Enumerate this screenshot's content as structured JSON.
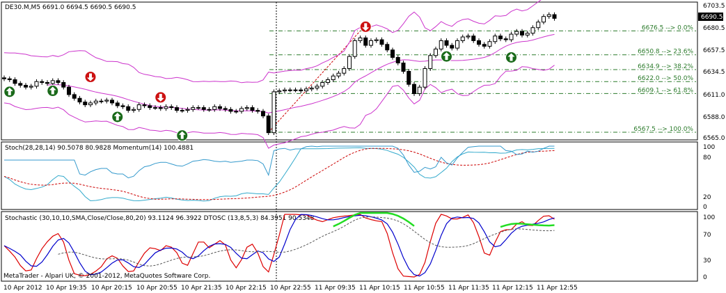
{
  "main": {
    "header": "DE30.M,M5  6691.0 6694.5 6690.5 6690.5",
    "price_badge": "6690.5",
    "price_ticks": [
      "6703.5",
      "6680.5",
      "6657.5",
      "6634.5",
      "6611.0",
      "6588.0",
      "6565.0"
    ],
    "fib_levels": [
      {
        "label": "6676.5 --> 0.0%"
      },
      {
        "label": "6650.8 --> 23.6%"
      },
      {
        "label": "6634.9 --> 38.2%"
      },
      {
        "label": "6622.0 --> 50.0%"
      },
      {
        "label": "6609.1 --> 61.8%"
      },
      {
        "label": "6567.5 --> 100.0%"
      }
    ]
  },
  "panel2": {
    "header": "Stoch(28,28,14) 90.5078 80.9828  Momentum(14) 100.4881",
    "ticks": [
      "100",
      "80",
      "20",
      "0"
    ]
  },
  "panel3": {
    "header": "Stochastic (30,10,10,SMA,Close/Close,80,20) 93.1124 96.3922  DTOSC (13,8,5,3) 84.3951 90.5348",
    "ticks": [
      "100",
      "70",
      "30",
      "0"
    ]
  },
  "footer": {
    "copyright": "MetaTrader - Alpari UK, © 2001-2012, MetaQuotes Software Corp.",
    "time_labels": [
      "10 Apr 2012",
      "10 Apr 19:35",
      "10 Apr 20:15",
      "10 Apr 20:55",
      "10 Apr 21:35",
      "10 Apr 22:15",
      "10 Apr 22:55",
      "11 Apr 09:35",
      "11 Apr 10:15",
      "11 Apr 10:55",
      "11 Apr 11:35",
      "11 Apr 12:15",
      "11 Apr 12:55"
    ]
  },
  "chart_data": {
    "type": "candlestick",
    "symbol": "DE30.M",
    "timeframe": "M5",
    "ylim": [
      6560,
      6706
    ],
    "close": [
      6625,
      6624,
      6620,
      6618,
      6616,
      6617,
      6622,
      6621,
      6620,
      6623,
      6621,
      6616,
      6608,
      6604,
      6600,
      6597,
      6599,
      6601,
      6601,
      6602,
      6599,
      6596,
      6595,
      6591,
      6592,
      6597,
      6596,
      6594,
      6594,
      6593,
      6595,
      6594,
      6591,
      6591,
      6592,
      6594,
      6594,
      6592,
      6592,
      6595,
      6593,
      6592,
      6590,
      6590,
      6593,
      6594,
      6591,
      6590,
      6585,
      6567,
      6611,
      6612,
      6613,
      6613,
      6613,
      6612,
      6614,
      6615,
      6617,
      6621,
      6624,
      6628,
      6631,
      6636,
      6649,
      6666,
      6669,
      6661,
      6666,
      6667,
      6662,
      6656,
      6648,
      6642,
      6633,
      6619,
      6609,
      6616,
      6636,
      6650,
      6657,
      6666,
      6661,
      6658,
      6666,
      6670,
      6671,
      6666,
      6662,
      6660,
      6665,
      6671,
      6668,
      6667,
      6673,
      6676,
      6672,
      6674,
      6680,
      6686,
      6692,
      6694,
      6690
    ]
  }
}
